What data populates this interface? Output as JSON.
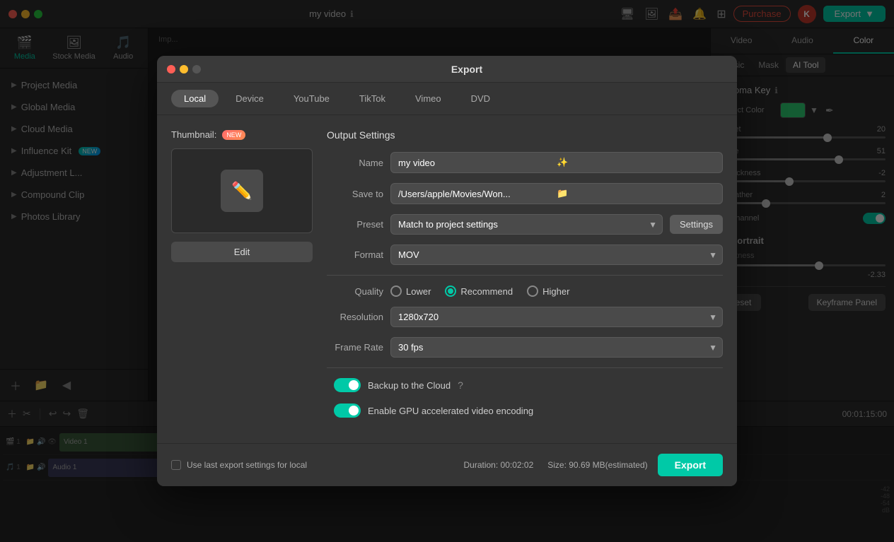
{
  "app": {
    "title": "my video",
    "window_dots": [
      "red",
      "yellow",
      "green"
    ]
  },
  "titlebar": {
    "title": "my video",
    "purchase_label": "Purchase",
    "export_label": "Export",
    "avatar_label": "K"
  },
  "toolbar_icons": [
    "monitor",
    "photo",
    "cloud-upload",
    "bell",
    "grid"
  ],
  "sidebar": {
    "tabs": [
      {
        "id": "media",
        "label": "Media",
        "icon": "🎬"
      },
      {
        "id": "stock",
        "label": "Stock Media",
        "icon": "🖼"
      },
      {
        "id": "audio",
        "label": "Audio",
        "icon": "🎵"
      }
    ],
    "items": [
      {
        "id": "project-media",
        "label": "Project Media",
        "has_badge": false
      },
      {
        "id": "global-media",
        "label": "Global Media",
        "has_badge": false
      },
      {
        "id": "cloud-media",
        "label": "Cloud Media",
        "has_badge": false
      },
      {
        "id": "influence-kit",
        "label": "Influence Kit",
        "has_badge": true,
        "badge_label": "NEW"
      },
      {
        "id": "adjustment-layer",
        "label": "Adjustment L...",
        "has_badge": false
      },
      {
        "id": "compound-clip",
        "label": "Compound Clip",
        "has_badge": false
      },
      {
        "id": "photos-library",
        "label": "Photos Library",
        "has_badge": false
      }
    ]
  },
  "right_panel": {
    "tabs": [
      "Video",
      "Audio",
      "Color"
    ],
    "subtabs": [
      "Basic",
      "Mask",
      "AI Tool"
    ],
    "active_tab": "Color",
    "active_subtab": "Basic",
    "section_title": "Chroma Key",
    "project_color_label": "Project Color",
    "sliders": [
      {
        "label": "preset",
        "value": 20,
        "percent": 65
      },
      {
        "label": "rance",
        "value": 51,
        "percent": 72
      },
      {
        "label": "e Thickness",
        "value": -2.0,
        "percent": 42
      },
      {
        "label": "e Feather",
        "value": 2.0,
        "percent": 28
      }
    ],
    "alpha_channel": {
      "label": "na Channel",
      "toggled": true
    }
  },
  "modal": {
    "title": "Export",
    "tabs": [
      {
        "id": "local",
        "label": "Local",
        "active": true
      },
      {
        "id": "device",
        "label": "Device"
      },
      {
        "id": "youtube",
        "label": "YouTube"
      },
      {
        "id": "tiktok",
        "label": "TikTok"
      },
      {
        "id": "vimeo",
        "label": "Vimeo"
      },
      {
        "id": "dvd",
        "label": "DVD"
      }
    ],
    "thumbnail_label": "Thumbnail:",
    "new_badge": "NEW",
    "edit_button": "Edit",
    "output_settings_title": "Output Settings",
    "form": {
      "name_label": "Name",
      "name_value": "my video",
      "save_to_label": "Save to",
      "save_to_value": "/Users/apple/Movies/Won...",
      "preset_label": "Preset",
      "preset_value": "Match to project settings",
      "settings_btn": "Settings",
      "format_label": "Format",
      "format_value": "MOV",
      "quality_label": "Quality",
      "quality_options": [
        {
          "id": "lower",
          "label": "Lower",
          "checked": false
        },
        {
          "id": "recommend",
          "label": "Recommend",
          "checked": true
        },
        {
          "id": "higher",
          "label": "Higher",
          "checked": false
        }
      ],
      "resolution_label": "Resolution",
      "resolution_value": "1280x720",
      "framerate_label": "Frame Rate",
      "framerate_value": "30 fps",
      "backup_label": "Backup to the Cloud",
      "backup_toggled": true,
      "gpu_label": "Enable GPU accelerated video encoding",
      "gpu_toggled": true
    },
    "footer": {
      "checkbox_label": "Use last export settings for local",
      "duration_label": "Duration:",
      "duration_value": "00:02:02",
      "size_label": "Size: 90.69 MB(estimated)",
      "export_btn": "Export"
    }
  },
  "timeline": {
    "time": "00:01:15:00",
    "tracks": [
      {
        "type": "video",
        "label": "Video 1"
      },
      {
        "type": "audio",
        "label": "Audio 1"
      }
    ]
  }
}
